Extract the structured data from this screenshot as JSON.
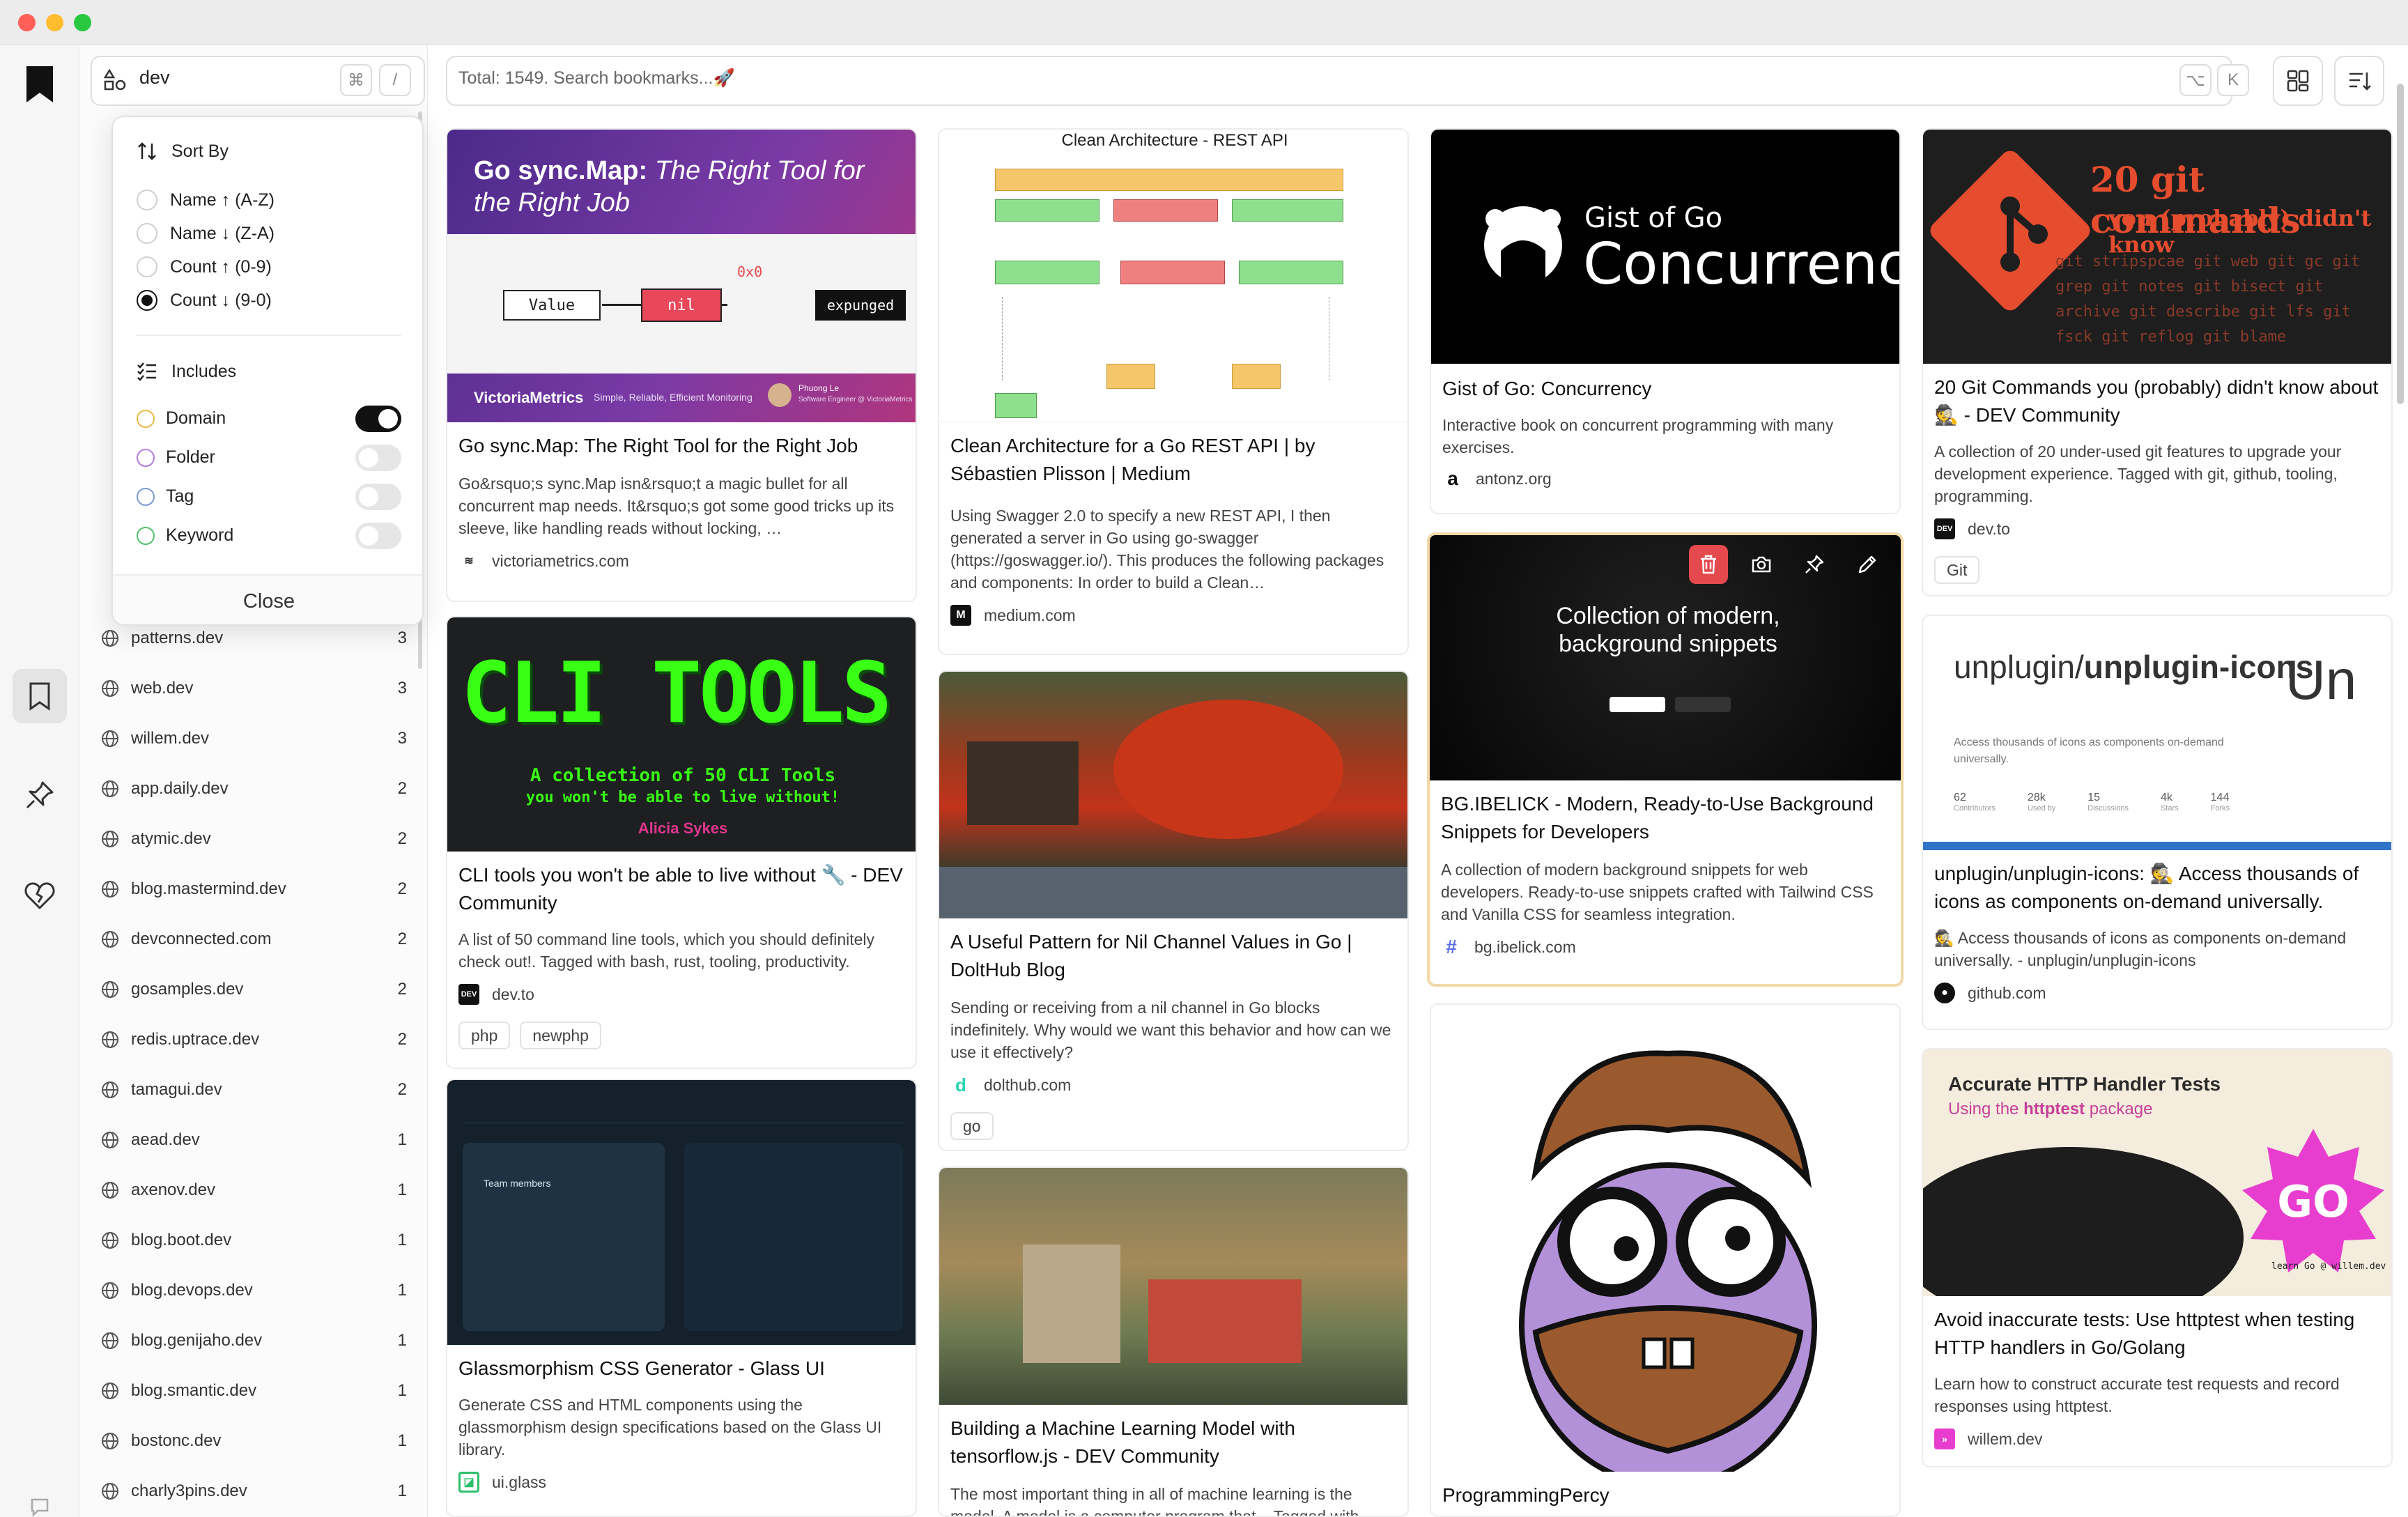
{
  "app": {
    "search_domain_value": "dev",
    "search_placeholder": "Total: 1549. Search bookmarks...🚀",
    "kbd_cmd": "⌘",
    "kbd_slash": "/",
    "kbd_opt": "⌥",
    "kbd_k": "K"
  },
  "popover": {
    "sort_by": "Sort By",
    "sort_options": [
      "Name ↑ (A-Z)",
      "Name ↓ (Z-A)",
      "Count ↑ (0-9)",
      "Count ↓ (9-0)"
    ],
    "selected_sort": "Count ↓ (9-0)",
    "includes": "Includes",
    "include_items": [
      {
        "label": "Domain",
        "on": true,
        "color": "#e9b948"
      },
      {
        "label": "Folder",
        "on": false,
        "color": "#b57be0"
      },
      {
        "label": "Tag",
        "on": false,
        "color": "#7a9ccf"
      },
      {
        "label": "Keyword",
        "on": false,
        "color": "#4fc36b"
      }
    ],
    "close": "Close"
  },
  "domains": [
    {
      "name": "patterns.dev",
      "count": "3"
    },
    {
      "name": "web.dev",
      "count": "3"
    },
    {
      "name": "willem.dev",
      "count": "3"
    },
    {
      "name": "app.daily.dev",
      "count": "2"
    },
    {
      "name": "atymic.dev",
      "count": "2"
    },
    {
      "name": "blog.mastermind.dev",
      "count": "2"
    },
    {
      "name": "devconnected.com",
      "count": "2"
    },
    {
      "name": "gosamples.dev",
      "count": "2"
    },
    {
      "name": "redis.uptrace.dev",
      "count": "2"
    },
    {
      "name": "tamagui.dev",
      "count": "2"
    },
    {
      "name": "aead.dev",
      "count": "1"
    },
    {
      "name": "axenov.dev",
      "count": "1"
    },
    {
      "name": "blog.boot.dev",
      "count": "1"
    },
    {
      "name": "blog.devops.dev",
      "count": "1"
    },
    {
      "name": "blog.genijaho.dev",
      "count": "1"
    },
    {
      "name": "blog.smantic.dev",
      "count": "1"
    },
    {
      "name": "bostonc.dev",
      "count": "1"
    },
    {
      "name": "charly3pins.dev",
      "count": "1"
    }
  ],
  "cards": [
    {
      "thumb_title_a": "Go sync.Map:",
      "thumb_title_b": "The Right Tool for the Right Job",
      "thumb_value": "Value",
      "thumb_nil": "nil",
      "thumb_expunged": "expunged",
      "thumb_0x0": "0x0",
      "thumb_brand": "VictoriaMetrics",
      "thumb_tagline": "Simple, Reliable, Efficient Monitoring",
      "thumb_author": "Phuong Le",
      "thumb_role": "Software Engineer @ VictoriaMetrics",
      "title": "Go sync.Map: The Right Tool for the Right Job",
      "desc": "Go&rsquo;s sync.Map isn&rsquo;t a magic bullet for all concurrent map needs. It&rsquo;s got some good tricks up its sleeve, like handling reads without locking, …",
      "site": "victoriametrics.com"
    },
    {
      "thumb_title": "CLI TOOLS",
      "thumb_sub1": "A collection of 50 CLI Tools",
      "thumb_sub2": "you won't be able to live without!",
      "thumb_author": "Alicia Sykes",
      "title": "CLI tools you won't be able to live without 🔧 - DEV Community",
      "desc": "A list of 50 command line tools, which you should definitely check out!. Tagged with bash, rust, tooling, productivity.",
      "site": "dev.to",
      "tags": [
        "php",
        "newphp"
      ]
    },
    {
      "thumb_label": "Team members",
      "title": "Glassmorphism CSS Generator - Glass UI",
      "desc": "Generate CSS and HTML components using the glassmorphism design specifications based on the Glass UI library.",
      "site": "ui.glass"
    },
    {
      "thumb_title": "Clean Architecture - REST API",
      "title": "Clean Architecture for a Go REST API | by Sébastien Plisson | Medium",
      "desc": "Using Swagger 2.0 to specify a new REST API, I then generated a server in Go using go-swagger (https://goswagger.io/). This produces the following packages and components: In order to build a Clean…",
      "site": "medium.com"
    },
    {
      "title": "A Useful Pattern for Nil Channel Values in Go | DoltHub Blog",
      "desc": "Sending or receiving from a nil channel in Go blocks indefinitely. Why would we want this behavior and how can we use it effectively?",
      "site": "dolthub.com",
      "tags": [
        "go"
      ]
    },
    {
      "title": "Building a Machine Learning Model with tensorflow.js - DEV Community",
      "desc": "The most important thing in all of machine learning is the model. A model is a computer program that... Tagged with",
      "site": ""
    },
    {
      "thumb_title_a": "Gist of Go",
      "thumb_title_b": "Concurrency",
      "title": "Gist of Go: Concurrency",
      "desc": "Interactive book on concurrent programming with many exercises.",
      "site": "antonz.org"
    },
    {
      "thumb_title_a": "Collection of modern,",
      "thumb_title_b": "background snippets",
      "title": "BG.IBELICK - Modern, Ready-to-Use Background Snippets for Developers",
      "desc": "A collection of modern background snippets for web developers. Ready-to-use snippets crafted with Tailwind CSS and Vanilla CSS for seamless integration.",
      "site": "bg.ibelick.com"
    },
    {
      "title": "ProgrammingPercy",
      "desc": "",
      "site": ""
    },
    {
      "thumb_title_a": "20 git commands",
      "thumb_title_b": "you (probably) didn't know",
      "thumb_cmds": "git stripspcae  git web  git gc  git grep  git notes  git bisect  git archive  git describe  git lfs  git fsck  git reflog  git blame",
      "title": "20 Git Commands you (probably) didn't know about 🕵 - DEV Community",
      "desc": "A collection of 20 under-used git features to upgrade your development experience. Tagged with git, github, tooling, programming.",
      "site": "dev.to",
      "tags": [
        "Git"
      ]
    },
    {
      "thumb_title_a": "unplugin/",
      "thumb_title_b": "unplugin-icons",
      "thumb_sub": "Access thousands of icons as components on-demand universally.",
      "thumb_stats": [
        {
          "v": "62",
          "l": "Contributors"
        },
        {
          "v": "28k",
          "l": "Used by"
        },
        {
          "v": "15",
          "l": "Discussions"
        },
        {
          "v": "4k",
          "l": "Stars"
        },
        {
          "v": "144",
          "l": "Forks"
        }
      ],
      "title": "unplugin/unplugin-icons: 🕵 Access thousands of icons as components on-demand universally.",
      "desc": "🕵 Access thousands of icons as components on-demand universally. - unplugin/unplugin-icons",
      "site": "github.com"
    },
    {
      "thumb_title": "Accurate HTTP Handler Tests",
      "thumb_sub_a": "Using the ",
      "thumb_sub_b": "httptest",
      "thumb_sub_c": " package",
      "thumb_footer": "learn Go @ willem.dev",
      "title": "Avoid inaccurate tests: Use httptest when testing HTTP handlers in Go/Golang",
      "desc": "Learn how to construct accurate test requests and record responses using httptest.",
      "site": "willem.dev"
    }
  ]
}
